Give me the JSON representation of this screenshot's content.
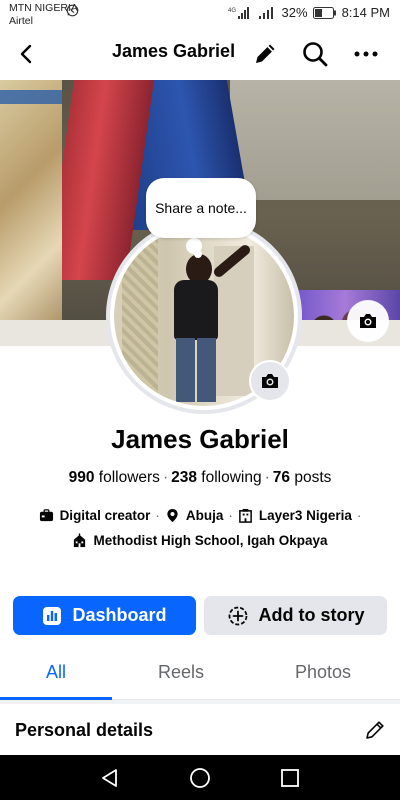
{
  "status_bar": {
    "carrier_primary": "MTN NIGERIA",
    "carrier_secondary": "Airtel",
    "battery_percent": "32%",
    "time": "8:14 PM",
    "network_label": "4G"
  },
  "appbar": {
    "title": "James Gabriel",
    "icons": [
      "back-arrow-icon",
      "pencil-icon",
      "search-icon",
      "more-dots-icon"
    ]
  },
  "note": {
    "placeholder": "Share a note..."
  },
  "profile": {
    "name": "James Gabriel",
    "followers_count": "990",
    "followers_label": "followers",
    "following_count": "238",
    "following_label": "following",
    "posts_count": "76",
    "posts_label": "posts",
    "separator": "·"
  },
  "details": {
    "role": "Digital creator",
    "location": "Abuja",
    "workplace": "Layer3 Nigeria",
    "school": "Methodist High School, Igah Okpaya",
    "separator": "·"
  },
  "actions": {
    "dashboard_label": "Dashboard",
    "add_story_label": "Add to story"
  },
  "tabs": {
    "items": [
      {
        "label": "All",
        "active": true
      },
      {
        "label": "Reels",
        "active": false
      },
      {
        "label": "Photos",
        "active": false
      }
    ]
  },
  "section": {
    "personal_details_title": "Personal details"
  },
  "colors": {
    "accent": "#0866ff",
    "button_secondary": "#e4e6eb",
    "text_primary": "#050505",
    "text_secondary": "#65676b"
  }
}
